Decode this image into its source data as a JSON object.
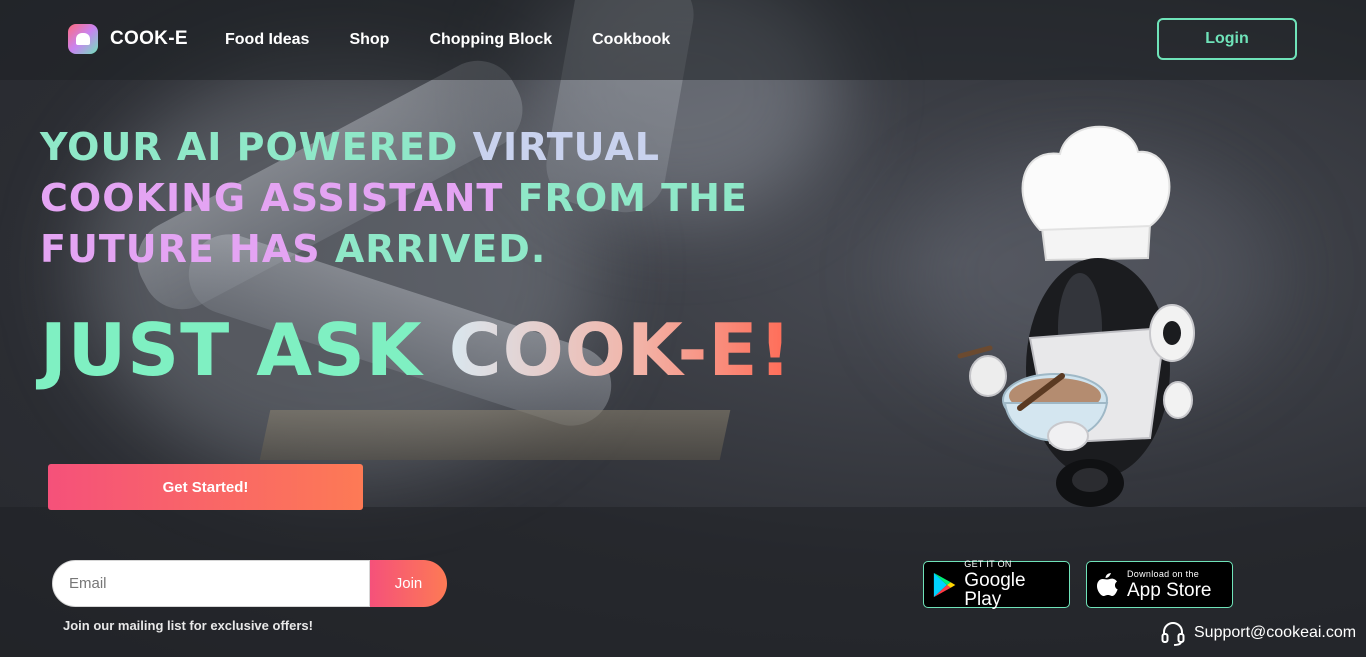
{
  "brand": {
    "name": "COOK-E"
  },
  "nav": {
    "links": [
      "Food Ideas",
      "Shop",
      "Chopping Block",
      "Cookbook"
    ],
    "login_label": "Login"
  },
  "hero": {
    "headline_1": "YOUR AI POWERED ",
    "headline_2": "VIRTUAL ",
    "headline_3": "COOKING ASSISTANT ",
    "headline_4": "FROM THE ",
    "headline_5": "FUTURE HAS ",
    "headline_6": "ARRIVED.",
    "tagline_1": "JUST ASK ",
    "tagline_2": "COOK-E!",
    "cta_label": "Get Started!"
  },
  "signup": {
    "placeholder": "Email",
    "value": "",
    "join_label": "Join",
    "note": "Join our mailing list for exclusive offers!"
  },
  "stores": {
    "google": {
      "small": "GET IT ON",
      "big": "Google Play"
    },
    "apple": {
      "small": "Download on the",
      "big": "App Store"
    }
  },
  "support": {
    "email": "Support@cookeai.com"
  },
  "colors": {
    "accent": "#6fe3b9",
    "cta_start": "#f5517a",
    "cta_end": "#fd7a55"
  }
}
